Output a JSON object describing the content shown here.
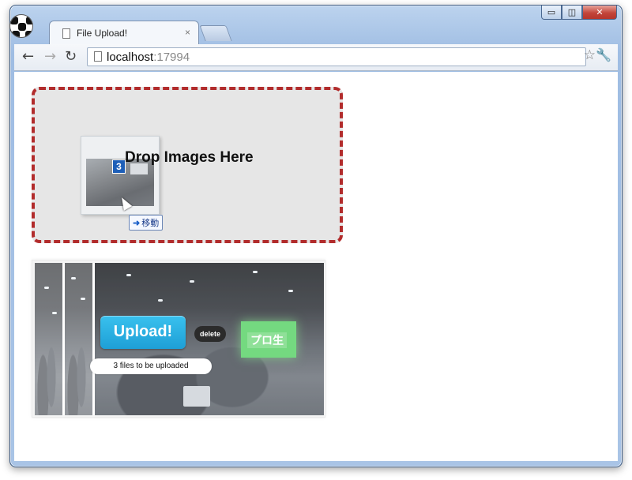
{
  "window": {
    "caption_minimize": "▭",
    "caption_maximize": "◫",
    "caption_close": "✕"
  },
  "browser": {
    "tab_title": "File Upload!",
    "tab_close": "×",
    "back_icon": "←",
    "forward_icon": "→",
    "reload_icon": "↻",
    "url_host": "localhost",
    "url_port": ":17994",
    "star_icon": "☆",
    "wrench_icon": "🔧"
  },
  "dropzone": {
    "label": "Drop Images Here",
    "drag_count": "3",
    "move_tooltip_arrow": "➜",
    "move_tooltip": "移動"
  },
  "preview": {
    "screen_text": "プロ生",
    "upload_label": "Upload!",
    "delete_label": "delete",
    "status_text": "3 files to be uploaded"
  },
  "colors": {
    "dropzone_border": "#b22c2c",
    "upload_button": "#1e9fd6",
    "projector_screen": "#5cd36a"
  }
}
